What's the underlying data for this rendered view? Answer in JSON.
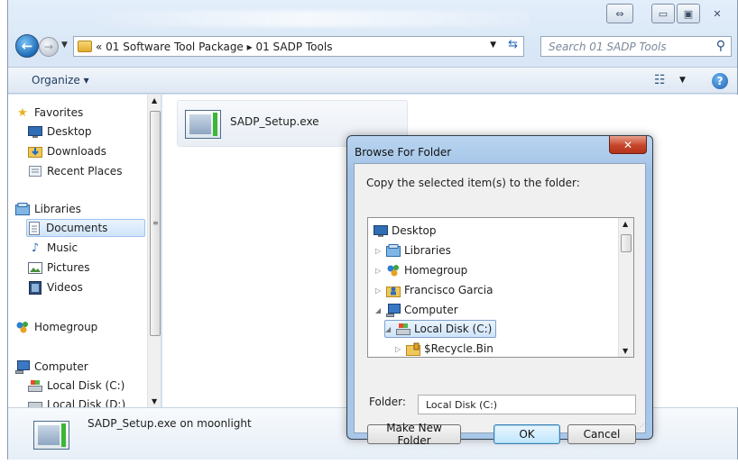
{
  "window": {
    "caption_buttons": [
      "⇔",
      "▭",
      "▣",
      "✕"
    ]
  },
  "address_bar": {
    "path": "« 01 Software Tool Package ▸ 01 SADP Tools",
    "search_placeholder": "Search 01 SADP Tools"
  },
  "command_bar": {
    "organize_label": "Organize ▾"
  },
  "nav_pane": {
    "favorites": {
      "label": "Favorites",
      "items": [
        "Desktop",
        "Downloads",
        "Recent Places"
      ]
    },
    "libraries": {
      "label": "Libraries",
      "items": [
        "Documents",
        "Music",
        "Pictures",
        "Videos"
      ],
      "selected": "Documents"
    },
    "homegroup": {
      "label": "Homegroup"
    },
    "computer": {
      "label": "Computer",
      "items": [
        "Local Disk (C:)",
        "Local Disk (D:)"
      ]
    }
  },
  "content": {
    "file_name": "SADP_Setup.exe"
  },
  "details_pane": {
    "text": "SADP_Setup.exe on moonlight"
  },
  "dialog": {
    "title": "Browse For Folder",
    "close_label": "✕",
    "prompt": "Copy the selected item(s) to the folder:",
    "tree": [
      {
        "label": "Desktop",
        "indent": 0,
        "expander": "",
        "icon": "desktop-icon"
      },
      {
        "label": "Libraries",
        "indent": 1,
        "expander": "▷",
        "icon": "libraries-icon"
      },
      {
        "label": "Homegroup",
        "indent": 1,
        "expander": "▷",
        "icon": "homegroup-icon"
      },
      {
        "label": "Francisco Garcia",
        "indent": 1,
        "expander": "▷",
        "icon": "user-folder-icon"
      },
      {
        "label": "Computer",
        "indent": 1,
        "expander": "◢",
        "icon": "computer-icon"
      },
      {
        "label": "Local Disk (C:)",
        "indent": 2,
        "expander": "◢",
        "icon": "drive-icon",
        "selected": true
      },
      {
        "label": "$Recycle.Bin",
        "indent": 3,
        "expander": "▷",
        "icon": "recycle-bin-icon"
      }
    ],
    "folder_label": "Folder:",
    "folder_value": "Local Disk (C:)",
    "make_new_folder_label": "Make New Folder",
    "ok_label": "OK",
    "cancel_label": "Cancel"
  }
}
